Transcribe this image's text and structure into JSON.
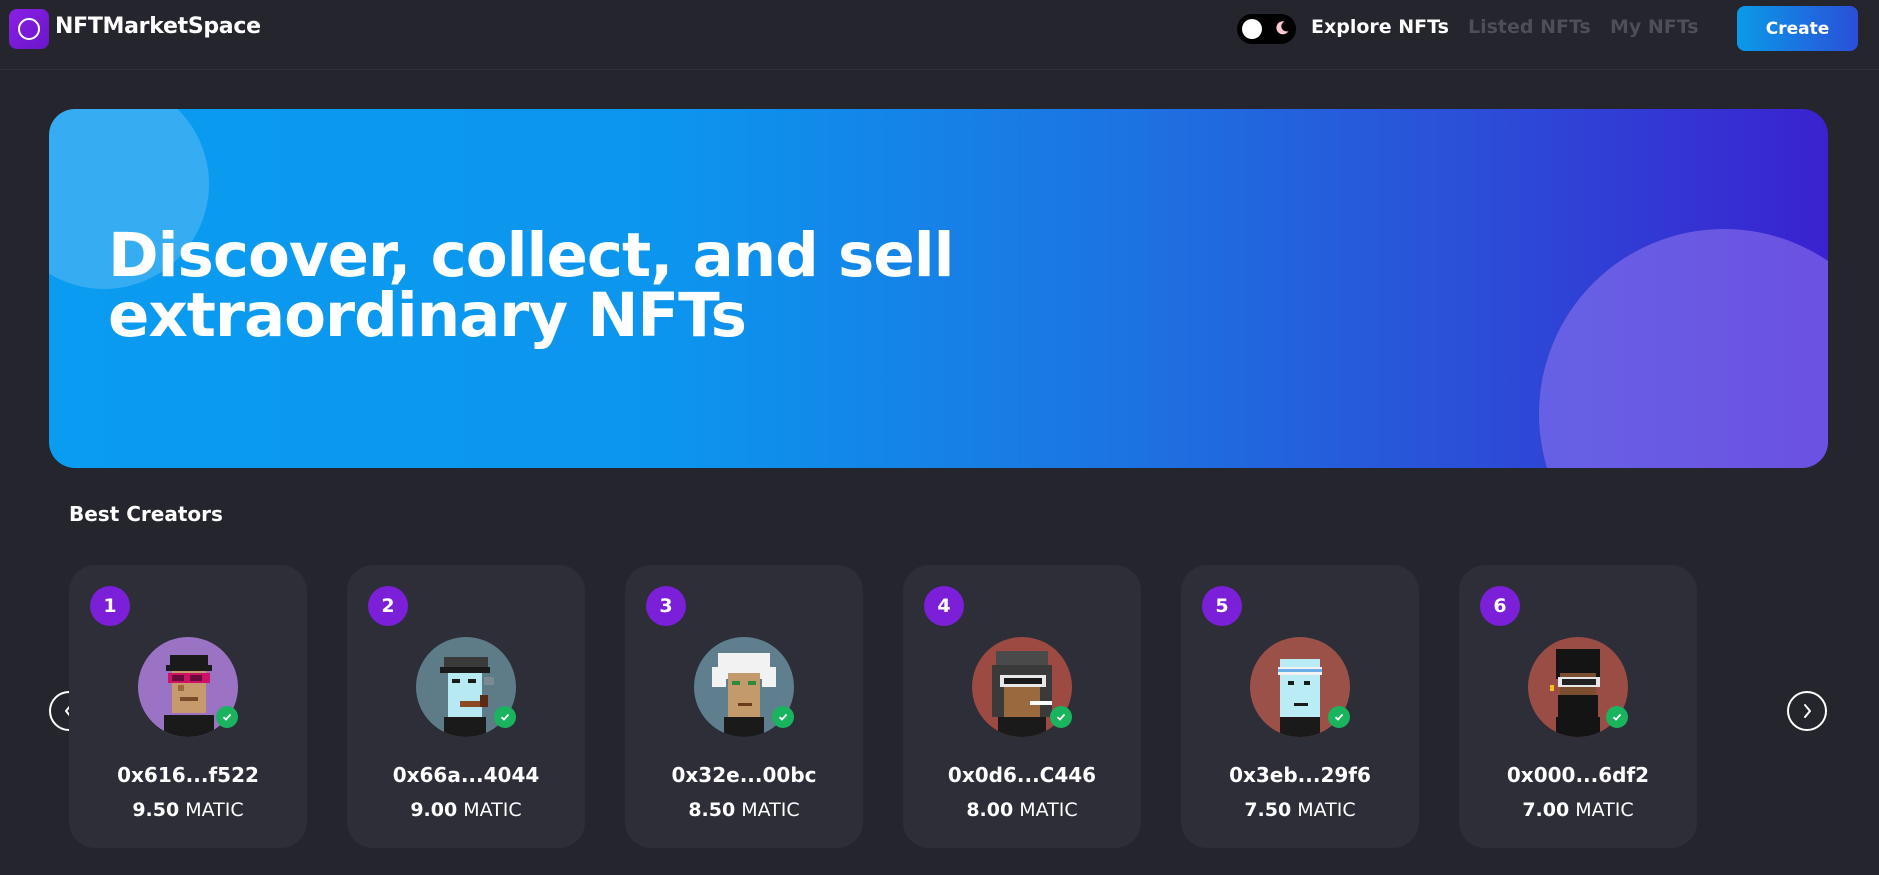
{
  "nav": {
    "brand": "NFTMarketSpace",
    "links": [
      {
        "label": "Explore NFTs",
        "active": true
      },
      {
        "label": "Listed NFTs",
        "active": false
      },
      {
        "label": "My NFTs",
        "active": false
      }
    ],
    "create_label": "Create"
  },
  "hero": {
    "title_line1": "Discover, collect, and sell",
    "title_line2": "extraordinary NFTs"
  },
  "creators": {
    "title": "Best Creators",
    "items": [
      {
        "rank": "1",
        "address": "0x616...f522",
        "amount": "9.50",
        "currency": "MATIC",
        "avatar_bg": "#9b73c4"
      },
      {
        "rank": "2",
        "address": "0x66a...4044",
        "amount": "9.00",
        "currency": "MATIC",
        "avatar_bg": "#5e7b88"
      },
      {
        "rank": "3",
        "address": "0x32e...00bc",
        "amount": "8.50",
        "currency": "MATIC",
        "avatar_bg": "#5f7f8f"
      },
      {
        "rank": "4",
        "address": "0x0d6...C446",
        "amount": "8.00",
        "currency": "MATIC",
        "avatar_bg": "#9c4a42"
      },
      {
        "rank": "5",
        "address": "0x3eb...29f6",
        "amount": "7.50",
        "currency": "MATIC",
        "avatar_bg": "#9c5148"
      },
      {
        "rank": "6",
        "address": "0x000...6df2",
        "amount": "7.00",
        "currency": "MATIC",
        "avatar_bg": "#9a4d45"
      }
    ]
  },
  "colors": {
    "background": "#24252d",
    "card": "#2d2e38",
    "accent": "#7b1fd9",
    "verified": "#1ab35e",
    "hero_start": "#0a9cf0",
    "hero_end": "#3a22d0"
  },
  "icons": {
    "logo": "ring-logo-icon",
    "theme_toggle": "moon-icon",
    "prev": "chevron-left-icon",
    "next": "chevron-right-icon",
    "verified": "check-badge-icon"
  }
}
